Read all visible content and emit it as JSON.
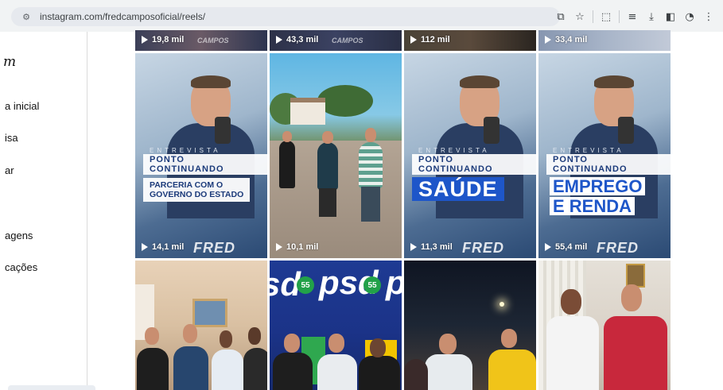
{
  "browser": {
    "url": "instagram.com/fredcamposoficial/reels/"
  },
  "sidebar": {
    "logo_partial": "m",
    "items": [
      {
        "label": "a inicial"
      },
      {
        "label": "isa"
      },
      {
        "label": "ar"
      },
      {
        "label": "agens"
      },
      {
        "label": "cações"
      }
    ]
  },
  "reels": {
    "row_top": [
      {
        "views": "19,8 mil"
      },
      {
        "views": "43,3 mil"
      },
      {
        "views": "112 mil"
      },
      {
        "views": "33,4 mil"
      }
    ],
    "row_mid": [
      {
        "views": "14,1 mil",
        "tag": "ENTREVISTA",
        "show": "PONTO CONTINUANDO",
        "subtitle_1": "PARCERIA COM O",
        "subtitle_2": "GOVERNO DO ESTADO",
        "watermark": "FRED"
      },
      {
        "views": "10,1 mil"
      },
      {
        "views": "11,3 mil",
        "tag": "ENTREVISTA",
        "show": "PONTO CONTINUANDO",
        "headline": "SAÚDE",
        "watermark": "FRED"
      },
      {
        "views": "55,4 mil",
        "tag": "ENTREVISTA",
        "show": "PONTO CONTINUANDO",
        "headline_1": "EMPREGO",
        "headline_2": "E RENDA",
        "watermark": "FRED"
      }
    ],
    "row_bottom": [
      {
        "caption": ""
      },
      {
        "brand_1": "psd",
        "brand_2": "psd",
        "badge": "55"
      },
      {
        "caption": ""
      },
      {
        "caption": ""
      }
    ],
    "top_watermarks": [
      "CAMPOS",
      "CAMPOS"
    ]
  },
  "colors": {
    "brand_blue": "#1e56c9",
    "psd_green": "#22a149"
  }
}
